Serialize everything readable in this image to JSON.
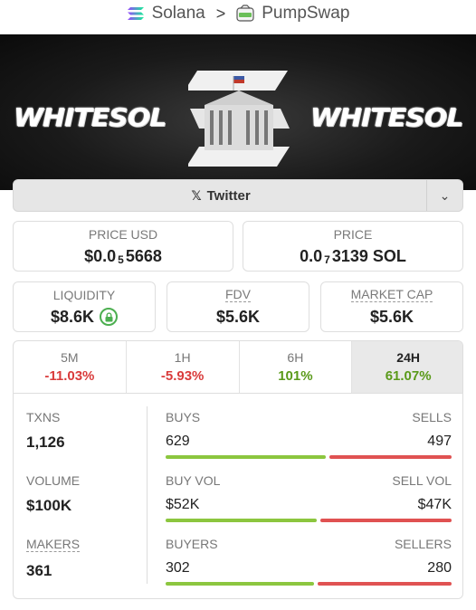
{
  "breadcrumb": {
    "chain": "Solana",
    "separator": ">",
    "dex": "PumpSwap"
  },
  "banner": {
    "left_word": "WHITESOL",
    "right_word": "WHITESOL"
  },
  "twitter": {
    "label": "Twitter",
    "x_glyph": "𝕏",
    "dropdown_glyph": "⌄"
  },
  "price_usd": {
    "label": "PRICE USD",
    "prefix": "$0.0",
    "zeros": "5",
    "digits": "5668"
  },
  "price_native": {
    "label": "PRICE",
    "prefix": "0.0",
    "zeros": "7",
    "digits": "3139 SOL"
  },
  "liquidity": {
    "label": "LIQUIDITY",
    "value": "$8.6K"
  },
  "fdv": {
    "label": "FDV",
    "value": "$5.6K"
  },
  "market_cap": {
    "label": "MARKET CAP",
    "value": "$5.6K"
  },
  "timeframes": [
    {
      "label": "5M",
      "change": "-11.03%",
      "trend": "neg"
    },
    {
      "label": "1H",
      "change": "-5.93%",
      "trend": "neg"
    },
    {
      "label": "6H",
      "change": "101%",
      "trend": "pos"
    },
    {
      "label": "24H",
      "change": "61.07%",
      "trend": "pos",
      "selected": true
    }
  ],
  "stats": {
    "txns": {
      "label": "TXNS",
      "value": "1,126"
    },
    "volume": {
      "label": "VOLUME",
      "value": "$100K"
    },
    "makers": {
      "label": "MAKERS",
      "value": "361"
    },
    "buys": {
      "left_label": "BUYS",
      "right_label": "SELLS",
      "left_value": "629",
      "right_value": "497",
      "buy_fraction": 0.56
    },
    "vol": {
      "left_label": "BUY VOL",
      "right_label": "SELL VOL",
      "left_value": "$52K",
      "right_value": "$47K",
      "buy_fraction": 0.53
    },
    "buyers": {
      "left_label": "BUYERS",
      "right_label": "SELLERS",
      "left_value": "302",
      "right_value": "280",
      "buy_fraction": 0.52
    }
  },
  "colors": {
    "positive": "#5a9a1a",
    "negative": "#d93b3b",
    "buy_bar": "#8cc63f",
    "sell_bar": "#e05252"
  }
}
